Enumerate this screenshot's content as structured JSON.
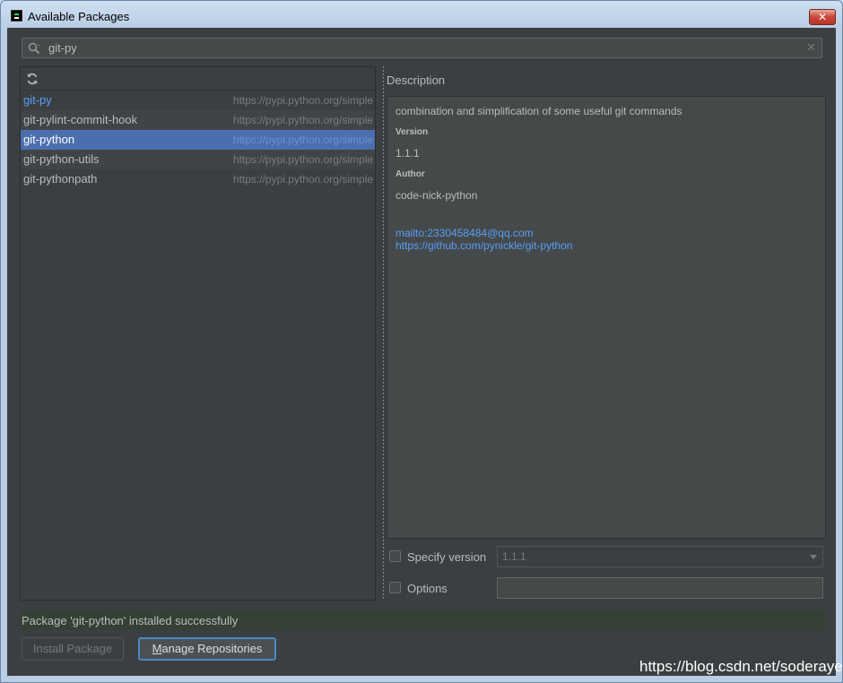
{
  "window": {
    "title": "Available Packages",
    "close_glyph": "✕"
  },
  "search": {
    "value": "git-py",
    "clear_glyph": "✕"
  },
  "packages": [
    {
      "name": "git-py",
      "repo": "https://pypi.python.org/simple"
    },
    {
      "name": "git-pylint-commit-hook",
      "repo": "https://pypi.python.org/simple"
    },
    {
      "name": "git-python",
      "repo": "https://pypi.python.org/simple"
    },
    {
      "name": "git-python-utils",
      "repo": "https://pypi.python.org/simple"
    },
    {
      "name": "git-pythonpath",
      "repo": "https://pypi.python.org/simple"
    }
  ],
  "details": {
    "heading": "Description",
    "description": "combination and simplification of some useful git commands",
    "version_label": "Version",
    "version": "1.1.1",
    "author_label": "Author",
    "author": "code-nick-python",
    "email": "mailto:2330458484@qq.com",
    "homepage": "https://github.com/pynickle/git-python"
  },
  "options": {
    "specify_version_label": "Specify version",
    "version_value": "1.1.1",
    "options_label": "Options",
    "options_value": ""
  },
  "status": {
    "message": "Package 'git-python' installed successfully"
  },
  "buttons": {
    "install_label": "Install Package",
    "manage_first_letter": "M",
    "manage_rest": "anage Repositories"
  },
  "watermark": "https://blog.csdn.net/soderayer",
  "colors": {
    "selection": "#4b6eaf",
    "link": "#589df6",
    "status_bg": "#344134"
  }
}
